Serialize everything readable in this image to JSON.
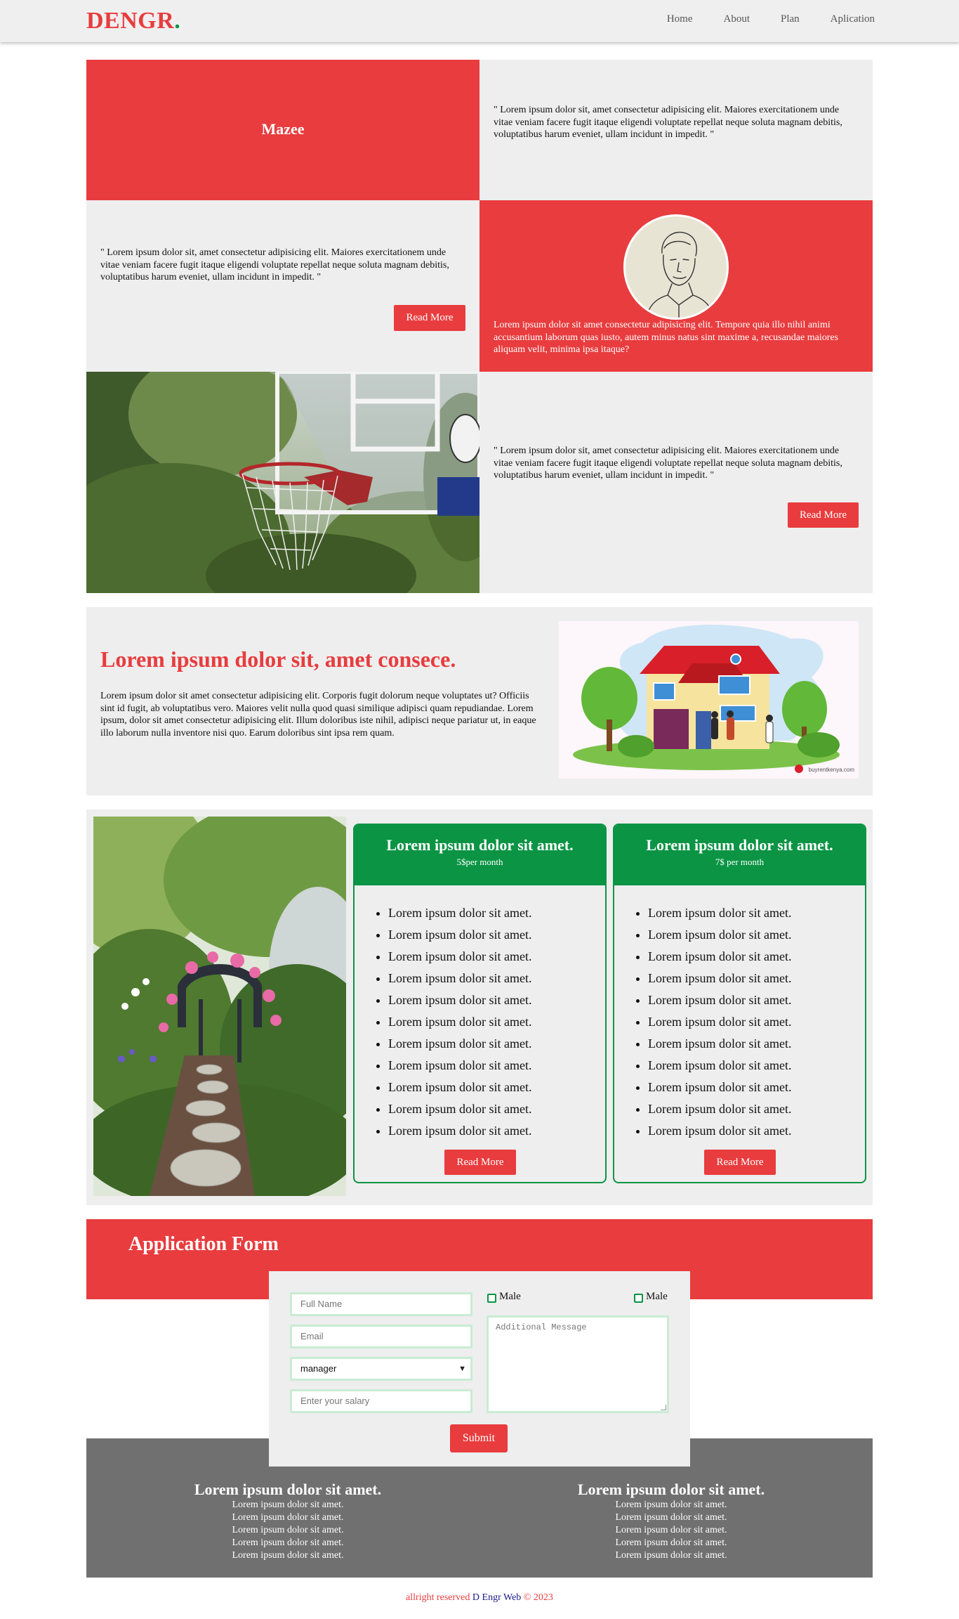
{
  "header": {
    "logo_text": "DENGR",
    "logo_dot": ".",
    "nav": [
      "Home",
      "About",
      "Plan",
      "Aplication"
    ]
  },
  "grid": {
    "mazee_title": "Mazee",
    "quote_1": "\" Lorem ipsum dolor sit, amet consectetur adipisicing elit. Maiores exercitationem unde vitae veniam facere fugit itaque eligendi voluptate repellat neque soluta magnam debitis, voluptatibus harum eveniet, ullam incidunt in impedit. \"",
    "quote_2": "\" Lorem ipsum dolor sit, amet consectetur adipisicing elit. Maiores exercitationem unde vitae veniam facere fugit itaque eligendi voluptate repellat neque soluta magnam debitis, voluptatibus harum eveniet, ullam incidunt in impedit. \"",
    "read_more_1": "Read More",
    "profile_text": "Lorem ipsum dolor sit amet consectetur adipisicing elit. Tempore quia illo nihil animi accusantium laborum quas iusto, autem minus natus sint maxime a, recusandae maiores aliquam velit, minima ipsa itaque?",
    "quote_3": "\" Lorem ipsum dolor sit, amet consectetur adipisicing elit. Maiores exercitationem unde vitae veniam facere fugit itaque eligendi voluptate repellat neque soluta magnam debitis, voluptatibus harum eveniet, ullam incidunt in impedit. \"",
    "read_more_2": "Read More"
  },
  "feature": {
    "title": "Lorem ipsum dolor sit, amet consece.",
    "body": "Lorem ipsum dolor sit amet consectetur adipisicing elit. Corporis fugit dolorum neque voluptates ut? Officiis sint id fugit, ab voluptatibus vero. Maiores velit nulla quod quasi similique adipisci quam repudiandae. Lorem ipsum, dolor sit amet consectetur adipisicing elit. Illum doloribus iste nihil, adipisci neque pariatur ut, in eaque illo laborum nulla inventore nisi quo. Earum doloribus sint ipsa rem quam.",
    "image_caption": "buyrentkenya.com"
  },
  "plans": [
    {
      "title": "Lorem ipsum dolor sit amet.",
      "price": "5$per month",
      "items": [
        "Lorem ipsum dolor sit amet.",
        "Lorem ipsum dolor sit amet.",
        "Lorem ipsum dolor sit amet.",
        "Lorem ipsum dolor sit amet.",
        "Lorem ipsum dolor sit amet.",
        "Lorem ipsum dolor sit amet.",
        "Lorem ipsum dolor sit amet.",
        "Lorem ipsum dolor sit amet.",
        "Lorem ipsum dolor sit amet.",
        "Lorem ipsum dolor sit amet.",
        "Lorem ipsum dolor sit amet."
      ],
      "button": "Read More"
    },
    {
      "title": "Lorem ipsum dolor sit amet.",
      "price": "7$ per month",
      "items": [
        "Lorem ipsum dolor sit amet.",
        "Lorem ipsum dolor sit amet.",
        "Lorem ipsum dolor sit amet.",
        "Lorem ipsum dolor sit amet.",
        "Lorem ipsum dolor sit amet.",
        "Lorem ipsum dolor sit amet.",
        "Lorem ipsum dolor sit amet.",
        "Lorem ipsum dolor sit amet.",
        "Lorem ipsum dolor sit amet.",
        "Lorem ipsum dolor sit amet.",
        "Lorem ipsum dolor sit amet."
      ],
      "button": "Read More"
    }
  ],
  "form": {
    "title": "Application Form",
    "full_name_placeholder": "Full Name",
    "email_placeholder": "Email",
    "role_selected": "manager",
    "salary_placeholder": "Enter your salary",
    "checkbox_1_label": "Male",
    "checkbox_2_label": "Male",
    "message_placeholder": "Additional Message",
    "submit": "Submit"
  },
  "footer": {
    "columns": [
      {
        "title": "Lorem ipsum dolor sit amet.",
        "lines": [
          "Lorem ipsum dolor sit amet.",
          "Lorem ipsum dolor sit amet.",
          "Lorem ipsum dolor sit amet.",
          "Lorem ipsum dolor sit amet.",
          "Lorem ipsum dolor sit amet."
        ]
      },
      {
        "title": "Lorem ipsum dolor sit amet.",
        "lines": [
          "Lorem ipsum dolor sit amet.",
          "Lorem ipsum dolor sit amet.",
          "Lorem ipsum dolor sit amet.",
          "Lorem ipsum dolor sit amet.",
          "Lorem ipsum dolor sit amet."
        ]
      }
    ],
    "copyright_prefix": "allright reserved ",
    "copyright_brand": "D Engr Web",
    "copyright_suffix": " © 2023"
  },
  "colors": {
    "accent": "#e83c3e",
    "green": "#0a9444",
    "panel": "#eeeeee",
    "footer": "#707070"
  }
}
